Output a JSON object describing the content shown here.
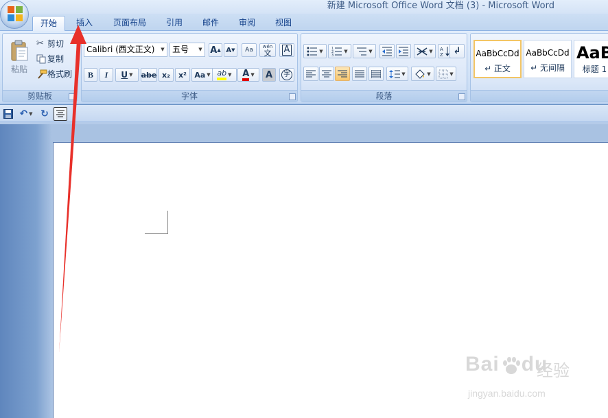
{
  "title": "新建 Microsoft Office Word 文档 (3) - Microsoft Word",
  "tabs": [
    {
      "label": "开始",
      "active": true
    },
    {
      "label": "插入",
      "active": false
    },
    {
      "label": "页面布局",
      "active": false
    },
    {
      "label": "引用",
      "active": false
    },
    {
      "label": "邮件",
      "active": false
    },
    {
      "label": "审阅",
      "active": false
    },
    {
      "label": "视图",
      "active": false
    }
  ],
  "clipboard": {
    "group_label": "剪贴板",
    "paste_label": "粘贴",
    "cut_label": "剪切",
    "copy_label": "复制",
    "format_painter_label": "格式刷"
  },
  "font": {
    "group_label": "字体",
    "font_name": "Calibri (西文正文)",
    "font_size": "五号",
    "bold": "B",
    "italic": "I",
    "underline": "U",
    "strikethrough": "abe",
    "subscript": "x₂",
    "superscript": "x²",
    "change_case": "Aa",
    "highlight_glyph": "ab",
    "font_color_glyph": "A",
    "char_shading_glyph": "A",
    "enclose_glyph": "字",
    "grow_glyph": "A",
    "shrink_glyph": "A",
    "clear_format_glyph": "Aa",
    "phonetic_glyph": "文",
    "phonetic_top": "wén",
    "char_border_glyph": "A",
    "highlight_color": "#ffff00",
    "font_color": "#e00000"
  },
  "paragraph": {
    "group_label": "段落"
  },
  "styles": {
    "items": [
      {
        "sample": "AaBbCcDd",
        "name": "↵ 正文",
        "selected": true
      },
      {
        "sample": "AaBbCcDd",
        "name": "↵ 无间隔",
        "selected": false
      },
      {
        "sample": "AaB",
        "name": "标题 1",
        "selected": false
      }
    ]
  },
  "watermark": {
    "brand": "Bai",
    "brand_end": "du",
    "cn": "经验",
    "url": "jingyan.baidu.com"
  },
  "colors": {
    "accent_blue": "#15428b",
    "arrow_red": "#e8302a",
    "selected_style_border": "#f3c564"
  }
}
